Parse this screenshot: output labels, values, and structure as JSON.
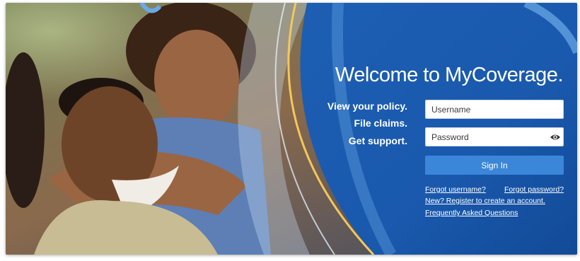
{
  "hero": {
    "title": "Welcome to MyCoverage.",
    "taglines": [
      "View your policy.",
      "File claims.",
      "Get support."
    ],
    "image_alt": "smiling couple embracing outdoors"
  },
  "login": {
    "username_placeholder": "Username",
    "password_placeholder": "Password",
    "sign_in_label": "Sign In",
    "show_password_icon": "eye-icon"
  },
  "links": {
    "forgot_username": "Forgot username?",
    "forgot_password": "Forgot password?",
    "register": "New? Register to create an account.",
    "faq": "Frequently Asked Questions"
  },
  "colors": {
    "panel_blue": "#1a59ad",
    "panel_blue_dark": "#124a97",
    "button_blue": "#3b86d8",
    "accent_gold": "#f3c75b"
  }
}
